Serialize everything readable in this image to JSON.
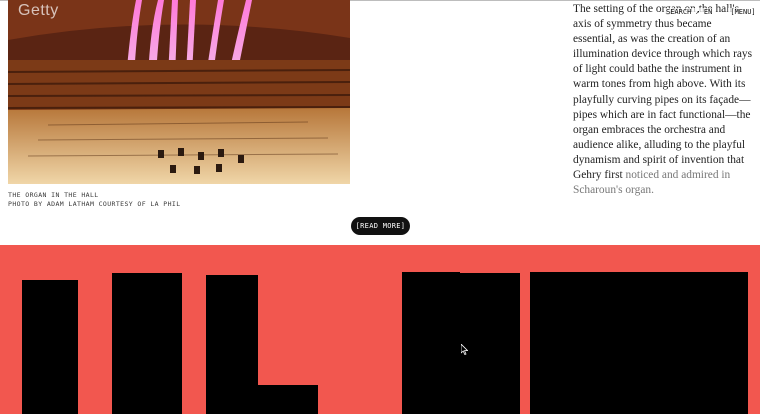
{
  "photo": {
    "watermark": "Getty",
    "caption_line1": "THE ORGAN IN THE HALL",
    "caption_line2": "PHOTO BY ADAM LATHAM COURTESY OF LA PHIL"
  },
  "article": {
    "paragraph": "The setting of the organ on the hall's axis of symmetry thus became essential, as was the creation of an illumination device through which rays of light could bathe the instrument in warm tones from high above. With its playfully curving pipes on its façade—pipes which are in fact functional—the organ embraces the orchestra and audience alike, alluding to the playful dynamism and spirit of invention that Gehry first",
    "faded_text": "noticed and admired in Scharoun's organ."
  },
  "nav": {
    "link1": "SEARCH ↗ EN",
    "link2": "[MENU]"
  },
  "read_more": {
    "label": "[READ MORE]"
  },
  "colors": {
    "banner": "#f2574f",
    "letters": "#000000",
    "button_bg": "#111111"
  }
}
